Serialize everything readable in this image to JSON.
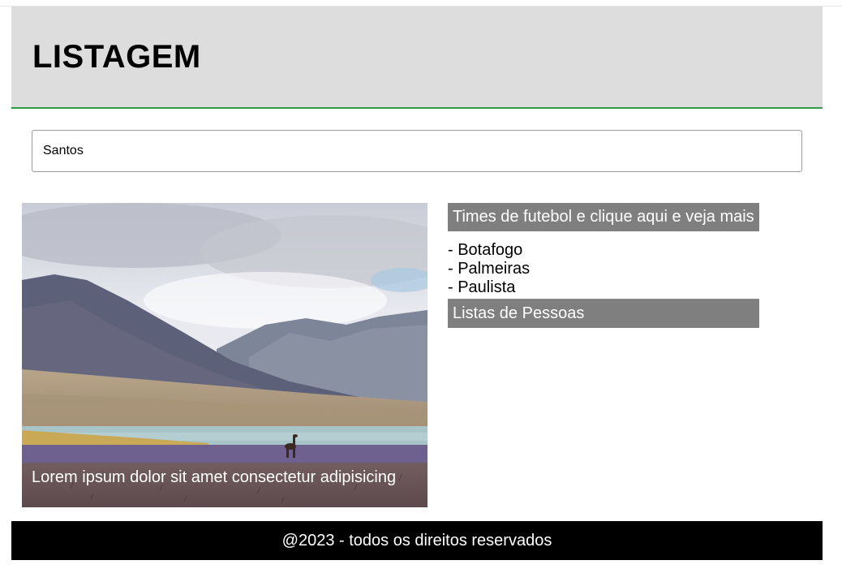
{
  "header": {
    "title": "LISTAGEM"
  },
  "search": {
    "value": "Santos"
  },
  "hero": {
    "caption": "Lorem ipsum dolor sit amet consectetur adipisicing"
  },
  "sidebar": {
    "teams_heading": "Times de futebol e clique aqui e veja mais",
    "teams": [
      "- Botafogo",
      "- Palmeiras",
      "- Paulista"
    ],
    "people_heading": "Listas de Pessoas"
  },
  "footer": {
    "text": "@2023 - todos os direitos reservados"
  },
  "colors": {
    "header_bg": "#dddddd",
    "header_border": "#2e9b43",
    "sidebar_heading_bg": "#7f7f7f",
    "footer_bg": "#000000"
  }
}
